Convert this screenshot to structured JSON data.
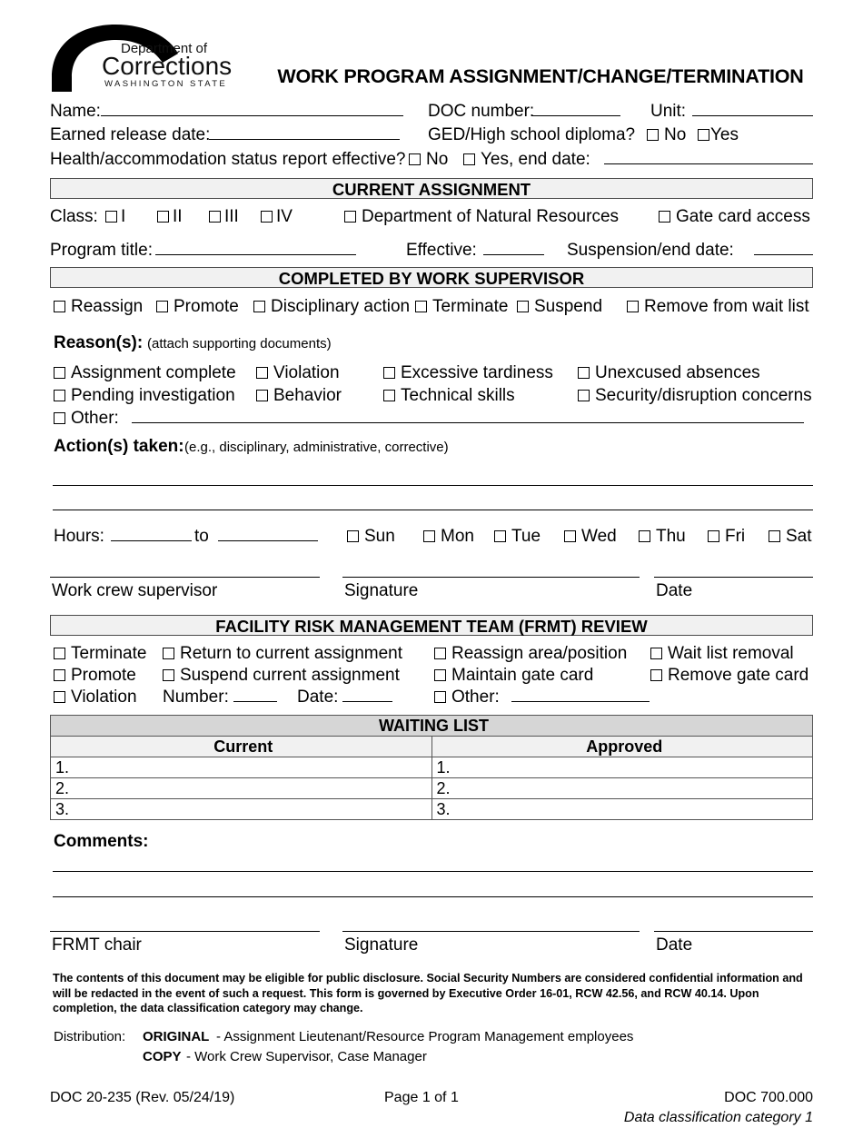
{
  "header": {
    "logo": {
      "line1": "Department of",
      "line2": "Corrections",
      "line3": "W A S H I N G T O N   S T A T E",
      "alt": "washington-state-department-of-corrections-logo"
    },
    "title": "WORK PROGRAM ASSIGNMENT/CHANGE/TERMINATION"
  },
  "identity": {
    "name_label": "Name:",
    "name_value": "",
    "doc_number_label": "DOC number:",
    "doc_number_value": "",
    "unit_label": "Unit:",
    "unit_value": "",
    "earned_release_label": "Earned release date:",
    "earned_release_value": "",
    "ged_label": "GED/High school diploma?",
    "ged_no": "No",
    "ged_yes": "Yes",
    "health_label": "Health/accommodation status report effective?",
    "health_no": "No",
    "health_yes": "Yes, end date:",
    "health_end_date_value": ""
  },
  "current_assignment": {
    "section_title": "CURRENT ASSIGNMENT",
    "class_label": "Class:",
    "classes": [
      "I",
      "II",
      "III",
      "IV"
    ],
    "dnr": "Department of Natural Resources",
    "gate_card": "Gate card access",
    "program_title_label": "Program title:",
    "program_title_value": "",
    "effective_label": "Effective:",
    "effective_value": "",
    "suspension_label": "Suspension/end date:",
    "suspension_value": ""
  },
  "work_supervisor": {
    "section_title": "COMPLETED BY WORK SUPERVISOR",
    "actions": [
      "Reassign",
      "Promote",
      "Disciplinary action",
      "Terminate",
      "Suspend",
      "Remove from wait list"
    ],
    "reasons_label": "Reason(s):",
    "reasons_note": "(attach supporting documents)",
    "reasons_col1": [
      "Assignment complete",
      "Pending investigation"
    ],
    "reasons_col2": [
      "Violation",
      "Behavior"
    ],
    "reasons_col3": [
      "Excessive tardiness",
      "Technical skills"
    ],
    "reasons_col4": [
      "Unexcused absences",
      "Security/disruption concerns"
    ],
    "other_label": "Other:",
    "other_value": "",
    "actions_taken_label": "Action(s) taken:",
    "actions_taken_note": "(e.g., disciplinary, administrative, corrective)",
    "actions_taken_line1": "",
    "actions_taken_line2": "",
    "hours_label": "Hours:",
    "hours_from_value": "",
    "hours_to_label": "to",
    "hours_to_value": "",
    "days": [
      "Sun",
      "Mon",
      "Tue",
      "Wed",
      "Thu",
      "Fri",
      "Sat"
    ],
    "sig_supervisor": "Work crew supervisor",
    "sig_signature": "Signature",
    "sig_date": "Date"
  },
  "frmt": {
    "section_title": "FACILITY RISK MANAGEMENT TEAM (FRMT) REVIEW",
    "col1": [
      "Terminate",
      "Promote",
      "Violation"
    ],
    "col2": [
      "Return to current assignment",
      "Suspend current assignment"
    ],
    "col3": [
      "Reassign area/position",
      "Maintain gate card"
    ],
    "col4": [
      "Wait list removal",
      "Remove gate card"
    ],
    "number_label": "Number:",
    "number_value": "",
    "date_label": "Date:",
    "date_value": "",
    "other_label": "Other:",
    "other_value": ""
  },
  "waiting_list": {
    "title": "WAITING LIST",
    "headers": [
      "Current",
      "Approved"
    ],
    "rows": [
      {
        "current": "1.",
        "approved": "1."
      },
      {
        "current": "2.",
        "approved": "2."
      },
      {
        "current": "3.",
        "approved": "3."
      }
    ]
  },
  "comments": {
    "label": "Comments:",
    "line1": "",
    "line2": "",
    "sig_chair": "FRMT chair",
    "sig_signature": "Signature",
    "sig_date": "Date"
  },
  "disclaimer": {
    "line1": "The contents of this document may be eligible for public disclosure.  Social Security Numbers are considered confidential information and",
    "line2": "will be redacted in the event of such a request.  This form is governed by Executive Order 16-01, RCW 42.56, and RCW 40.14.  Upon",
    "line3": "completion, the data classification category may change."
  },
  "distribution": {
    "label": "Distribution:",
    "original_bold": "ORIGINAL",
    "original_rest": " - Assignment Lieutenant/Resource Program Management employees",
    "copy_bold": "COPY",
    "copy_rest": " - Work Crew Supervisor, Case Manager"
  },
  "footer": {
    "form_id": "DOC 20-235 (Rev. 05/24/19)",
    "page": "Page 1 of 1",
    "doc_policy": "DOC 700.000",
    "classification": "Data classification category 1"
  }
}
